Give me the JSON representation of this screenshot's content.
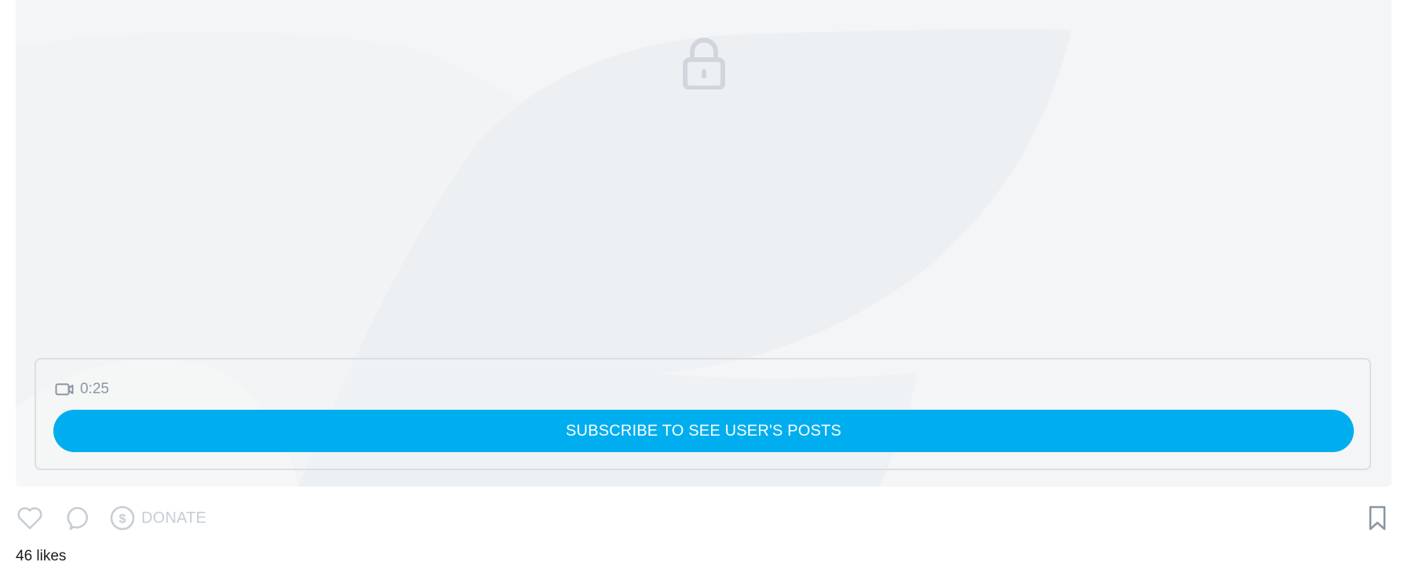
{
  "media": {
    "lock_icon": "lock-icon",
    "duration_icon": "video-camera-icon",
    "duration": "0:25",
    "subscribe_label": "SUBSCRIBE TO SEE USER'S POSTS"
  },
  "actions": {
    "like_icon": "heart-icon",
    "comment_icon": "comment-icon",
    "donate_icon": "dollar-circle-icon",
    "donate_label": "DONATE",
    "bookmark_icon": "bookmark-icon"
  },
  "likes": {
    "count": "46",
    "label": "likes"
  },
  "colors": {
    "accent": "#00aeef",
    "muted_icon": "#c7cdd4",
    "media_bg": "#f4f5f7"
  }
}
